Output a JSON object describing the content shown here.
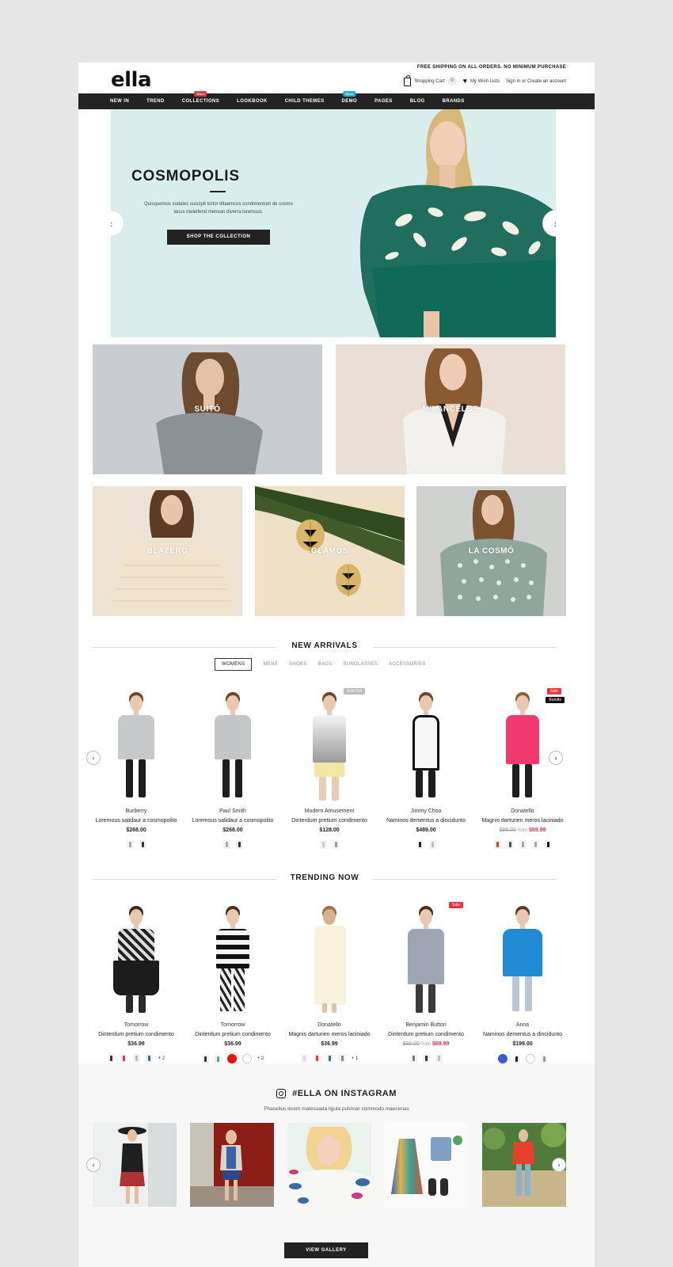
{
  "header": {
    "logo": "ella",
    "shipping": "FREE SHIPPING ON ALL ORDERS. NO MINIMUM PURCHASE",
    "cart_label": "Shopping Cart",
    "cart_count": "0",
    "wishlist_label": "My Wish Lists",
    "account_label": "Sign in or Create an account"
  },
  "nav": {
    "items": [
      "NEW IN",
      "TREND",
      "COLLECTIONS",
      "LOOKBOOK",
      "CHILD THEMES",
      "DEMO",
      "PAGES",
      "BLOG",
      "BRANDS"
    ],
    "badges": {
      "collections": "Sale",
      "demo": "New"
    },
    "colors": {
      "sale": "#e8383d",
      "new": "#1fb6d1"
    }
  },
  "hero": {
    "title": "COSMOPOLIS",
    "text": "Quisquemos sodales suscipit tortor ditaemcos condimentum de cosmo lacus meleifend menean diverra loremous.",
    "button": "SHOP THE COLLECTION",
    "prev": "‹",
    "next": "›"
  },
  "categories": [
    "SUITÓ",
    "MILANCÉLOS",
    "BLAZÉRO",
    "GLAMÓS",
    "LA COSMÓ"
  ],
  "new_arrivals": {
    "title": "NEW ARRIVALS",
    "tabs": [
      "WOMENS",
      "MENS",
      "SHOES",
      "BAGS",
      "SUNGLASSES",
      "ACCESSORIES"
    ],
    "products": [
      {
        "brand": "Burberry",
        "name": "Loremous salidaur a cosmopolito",
        "price": "$268.00"
      },
      {
        "brand": "Paul Smith",
        "name": "Loremous salidaur a cosmopolito",
        "price": "$268.00"
      },
      {
        "brand": "Modern Amusement",
        "name": "Dinterdum pretium condimento",
        "price": "$128.00",
        "tag": "Sold Out"
      },
      {
        "brand": "Jimmy Choo",
        "name": "Naminos dementus a dincidunto",
        "price": "$489.00"
      },
      {
        "brand": "Donatello",
        "name": "Magnis darturien meros laciniado",
        "old_price": "$86.00",
        "from": "from",
        "price": "$69.99",
        "tag": "Sale",
        "tag2": "Bundle"
      }
    ]
  },
  "trending": {
    "title": "TRENDING NOW",
    "products": [
      {
        "brand": "Tomorrow",
        "name": "Dinterdum pretium condimento",
        "price": "$36.99",
        "more": "+ 2"
      },
      {
        "brand": "Tomorrow",
        "name": "Dinterdum pretium condimento",
        "price": "$36.99",
        "more": "+ 2"
      },
      {
        "brand": "Donatello",
        "name": "Magnis darturien meros laciniado",
        "price": "$36.99",
        "more": "+ 1"
      },
      {
        "brand": "Benjamin Button",
        "name": "Dinterdum pretium condimento",
        "old_price": "$86.00",
        "from": "from",
        "price": "$69.99",
        "tag": "Sale"
      },
      {
        "brand": "Anna",
        "name": "Naminos dementus a dincidunto",
        "price": "$199.00"
      }
    ]
  },
  "instagram": {
    "title": "#ELLA ON INSTAGRAM",
    "subtitle": "Phasellus lorem malesuada ligula pulvinar commodo maecenas",
    "button": "VIEW GALLERY"
  }
}
